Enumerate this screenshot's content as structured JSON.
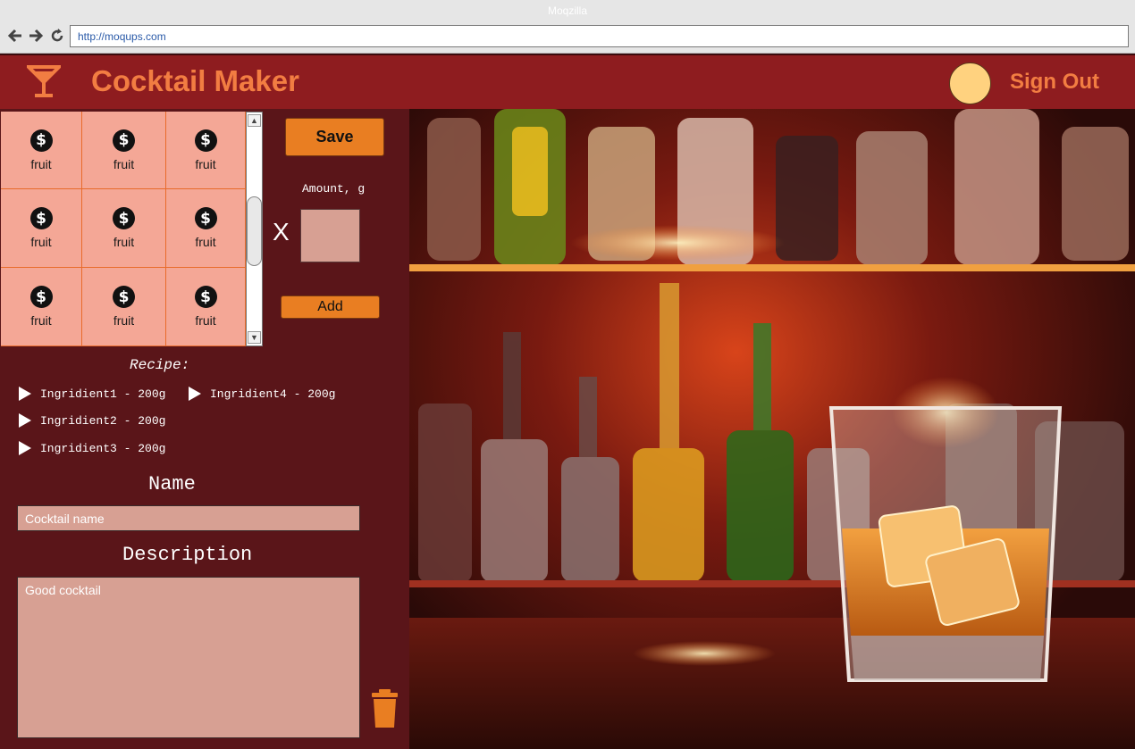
{
  "browser": {
    "window_title": "Moqzilla",
    "url": "http://moqups.com",
    "icons": [
      "back-arrow-icon",
      "forward-arrow-icon",
      "reload-icon"
    ]
  },
  "header": {
    "app_title": "Cocktail Maker",
    "logo_icon": "cocktail-glass-icon",
    "sign_out_label": "Sign Out",
    "colors": {
      "header_bg": "#8e1c1f",
      "accent": "#f27d42",
      "avatar": "#ffd27f"
    }
  },
  "ingredients": {
    "items": [
      {
        "icon": "dollar-icon",
        "label": "fruit"
      },
      {
        "icon": "dollar-icon",
        "label": "fruit"
      },
      {
        "icon": "dollar-icon",
        "label": "fruit"
      },
      {
        "icon": "dollar-icon",
        "label": "fruit"
      },
      {
        "icon": "dollar-icon",
        "label": "fruit"
      },
      {
        "icon": "dollar-icon",
        "label": "fruit"
      },
      {
        "icon": "dollar-icon",
        "label": "fruit"
      },
      {
        "icon": "dollar-icon",
        "label": "fruit"
      },
      {
        "icon": "dollar-icon",
        "label": "fruit"
      }
    ],
    "cell_bg": "#f4a796"
  },
  "controls": {
    "save_label": "Save",
    "amount_label": "Amount, g",
    "multiply_sign": "X",
    "amount_value": "",
    "add_label": "Add",
    "button_color": "#e97e22"
  },
  "recipe": {
    "title": "Recipe:",
    "items": [
      "Ingridient1 - 200g",
      "Ingridient2 - 200g",
      "Ingridient3 - 200g",
      "Ingridient4 - 200g"
    ]
  },
  "form": {
    "name_heading": "Name",
    "name_placeholder": "Cocktail name",
    "description_heading": "Description",
    "description_placeholder": "Good cocktail"
  },
  "bar_image": {
    "alt": "bar with bottles and a glass of whiskey"
  }
}
